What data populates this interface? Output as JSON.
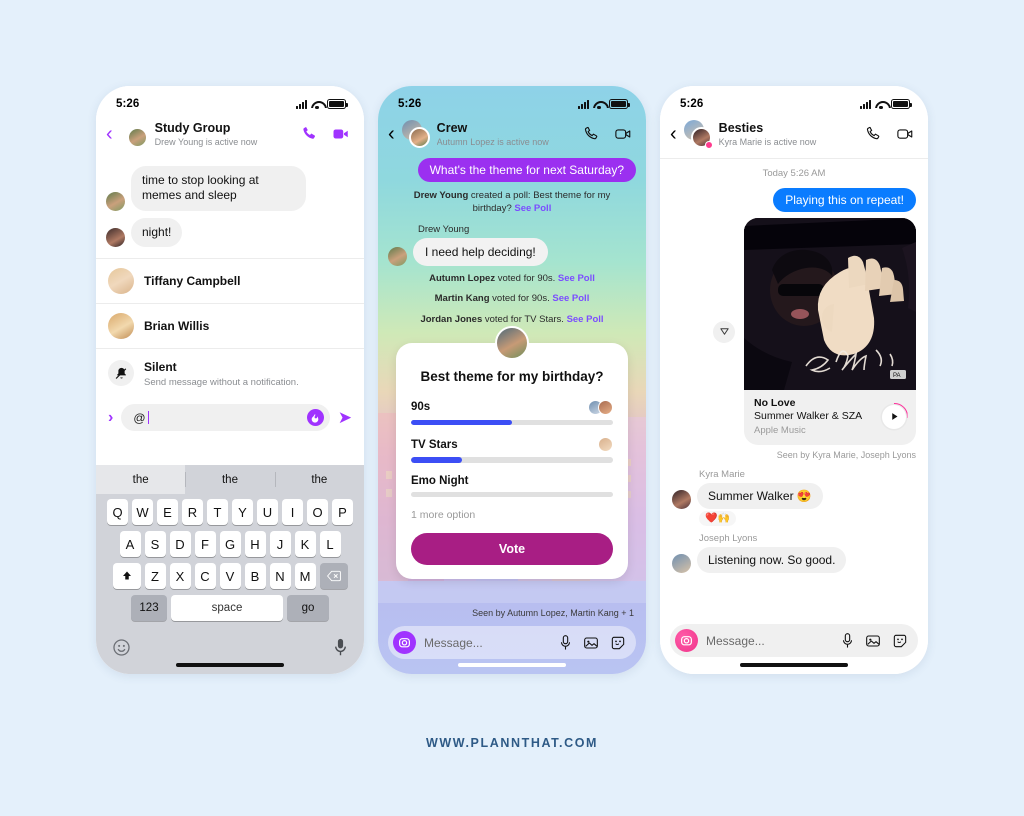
{
  "page": {
    "background": "#e4f0fb",
    "footer_text": "WWW.PLANNTHAT.COM",
    "footer_color": "#2e5a86"
  },
  "phone1": {
    "status": {
      "time": "5:26"
    },
    "header": {
      "title": "Study Group",
      "subtitle": "Drew Young is active now",
      "back_icon": "chevron-left-icon",
      "call_icon": "phone-icon",
      "video_icon": "video-camera-icon",
      "accent": "#a033ff"
    },
    "messages": [
      {
        "text": "time to stop looking at memes and sleep"
      },
      {
        "text": "night!"
      }
    ],
    "mention_list": [
      {
        "name": "Tiffany Campbell",
        "sub": ""
      },
      {
        "name": "Brian Willis",
        "sub": ""
      },
      {
        "name": "Silent",
        "sub": "Send message without a notification.",
        "icon": "bell-slash-icon"
      }
    ],
    "input": {
      "value": "@",
      "flame_icon": "flame-icon",
      "send_icon": "send-arrow-icon",
      "chevron_icon": "chevron-right-icon"
    },
    "keyboard": {
      "predictions": [
        "the",
        "the",
        "the"
      ],
      "row1": [
        "Q",
        "W",
        "E",
        "R",
        "T",
        "Y",
        "U",
        "I",
        "O",
        "P"
      ],
      "row2": [
        "A",
        "S",
        "D",
        "F",
        "G",
        "H",
        "J",
        "K",
        "L"
      ],
      "row3": [
        "Z",
        "X",
        "C",
        "V",
        "B",
        "N",
        "M"
      ],
      "shift_icon": "shift-icon",
      "backspace_icon": "backspace-icon",
      "num_key": "123",
      "space_key": "space",
      "go_key": "go",
      "emoji_icon": "emoji-icon",
      "mic_icon": "microphone-icon"
    }
  },
  "phone2": {
    "status": {
      "time": "5:26"
    },
    "header": {
      "title": "Crew",
      "subtitle": "Autumn Lopez is active now",
      "back_icon": "chevron-left-icon",
      "call_icon": "phone-icon",
      "video_icon": "video-camera-icon"
    },
    "outgoing_bubble": "What's the theme for next Saturday?",
    "system_lines": [
      {
        "actor": "Drew Young",
        "rest": " created a poll: Best theme for my birthday? ",
        "link": "See Poll"
      },
      {
        "actor": "Autumn Lopez",
        "rest": " voted for 90s. ",
        "link": "See Poll"
      },
      {
        "actor": "Martin Kang",
        "rest": " voted for 90s. ",
        "link": "See Poll"
      },
      {
        "actor": "Jordan Jones",
        "rest": " voted for TV Stars. ",
        "link": "See Poll"
      }
    ],
    "sender_name": "Drew Young",
    "incoming_bubble": "I need help deciding!",
    "poll": {
      "question": "Best theme for my birthday?",
      "options": [
        {
          "label": "90s",
          "percent": 50,
          "voters": 2
        },
        {
          "label": "TV Stars",
          "percent": 25,
          "voters": 1
        },
        {
          "label": "Emo Night",
          "percent": 0,
          "voters": 0
        }
      ],
      "more_text": "1 more option",
      "vote_label": "Vote",
      "vote_color": "#a81e84",
      "fill_color": "#3c4ef5"
    },
    "seen_text": "Seen by Autumn Lopez, Martin Kang + 1",
    "composer": {
      "placeholder": "Message...",
      "camera_icon": "camera-icon",
      "mic_icon": "microphone-icon",
      "photo_icon": "photo-icon",
      "sticker_icon": "sticker-icon"
    }
  },
  "phone3": {
    "status": {
      "time": "5:26"
    },
    "header": {
      "title": "Besties",
      "subtitle": "Kyra Marie is active now",
      "back_icon": "chevron-left-icon",
      "call_icon": "phone-icon",
      "video_icon": "video-camera-icon"
    },
    "daystamp": "Today 5:26 AM",
    "outgoing_bubble": "Playing this on repeat!",
    "reply_icon": "reply-triangle-icon",
    "music": {
      "title": "No Love",
      "artist": "Summer Walker & SZA",
      "source": "Apple Music",
      "play_icon": "play-icon",
      "accent": "#ff2d9b"
    },
    "seen_text": "Seen by Kyra Marie, Joseph Lyons",
    "replies": [
      {
        "name": "Kyra Marie",
        "text": "Summer Walker 😍",
        "reactions": "❤️🙌"
      },
      {
        "name": "Joseph Lyons",
        "text": "Listening now. So good.",
        "reactions": ""
      }
    ],
    "composer": {
      "placeholder": "Message...",
      "camera_icon": "camera-icon",
      "mic_icon": "microphone-icon",
      "photo_icon": "photo-icon",
      "sticker_icon": "sticker-icon"
    }
  }
}
